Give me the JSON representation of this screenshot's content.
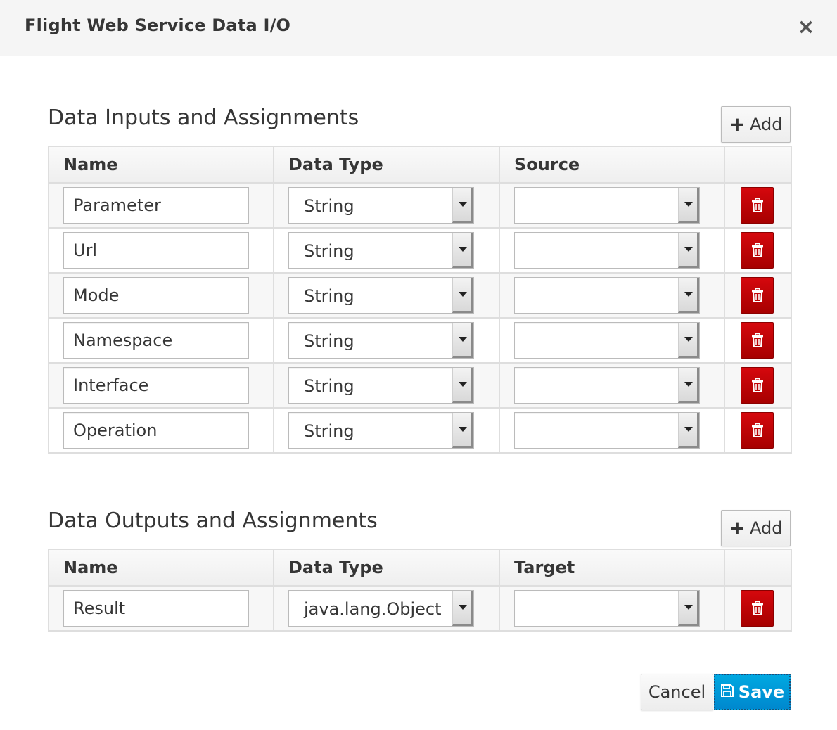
{
  "dialog": {
    "title": "Flight Web Service Data I/O",
    "close_symbol": "×"
  },
  "inputs": {
    "title": "Data Inputs and Assignments",
    "add_label": "Add",
    "add_symbol": "+",
    "headers": [
      "Name",
      "Data Type",
      "Source",
      ""
    ],
    "rows": [
      {
        "name": "Parameter",
        "data_type": "String",
        "source": ""
      },
      {
        "name": "Url",
        "data_type": "String",
        "source": ""
      },
      {
        "name": "Mode",
        "data_type": "String",
        "source": ""
      },
      {
        "name": "Namespace",
        "data_type": "String",
        "source": ""
      },
      {
        "name": "Interface",
        "data_type": "String",
        "source": ""
      },
      {
        "name": "Operation",
        "data_type": "String",
        "source": ""
      }
    ]
  },
  "outputs": {
    "title": "Data Outputs and Assignments",
    "add_label": "Add",
    "add_symbol": "+",
    "headers": [
      "Name",
      "Data Type",
      "Target",
      ""
    ],
    "rows": [
      {
        "name": "Result",
        "data_type": "java.lang.Object",
        "target": ""
      }
    ]
  },
  "footer": {
    "cancel_label": "Cancel",
    "save_label": "Save"
  },
  "icons": {
    "delete": "trash-icon",
    "save": "floppy-disk-icon",
    "add": "plus-icon",
    "close": "close-icon",
    "dropdown": "caret-down-icon"
  },
  "colors": {
    "delete_button": "#cc0000",
    "save_button": "#0099d3",
    "header_background": "#f5f5f5"
  }
}
